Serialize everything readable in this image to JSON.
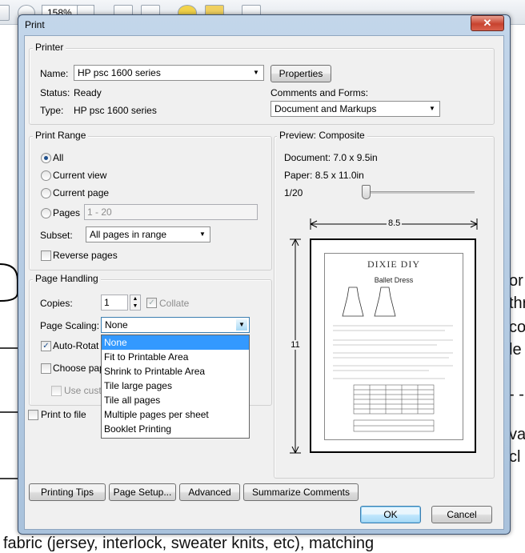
{
  "background": {
    "zoom": "158%",
    "doc_text_right": [
      "or",
      "thr",
      "co",
      "le",
      "- -",
      "va",
      "cl"
    ],
    "doc_text_bottom": "fabric (jersey, interlock, sweater knits, etc), matching"
  },
  "dialog": {
    "title": "Print",
    "close_glyph": "✕",
    "printer": {
      "group_label": "Printer",
      "name_label": "Name:",
      "name_value": "HP psc 1600 series",
      "properties_button": "Properties",
      "status_label": "Status:",
      "status_value": "Ready",
      "type_label": "Type:",
      "type_value": "HP psc 1600 series",
      "comments_label": "Comments and Forms:",
      "comments_value": "Document and Markups"
    },
    "print_range": {
      "group_label": "Print Range",
      "all": "All",
      "current_view": "Current view",
      "current_page": "Current page",
      "pages": "Pages",
      "pages_placeholder": "1 - 20",
      "subset_label": "Subset:",
      "subset_value": "All pages in range",
      "reverse_pages": "Reverse pages"
    },
    "page_handling": {
      "group_label": "Page Handling",
      "copies_label": "Copies:",
      "copies_value": "1",
      "collate": "Collate",
      "page_scaling_label": "Page Scaling:",
      "page_scaling_value": "None",
      "auto_rotate": "Auto-Rotat",
      "choose_paper": "Choose pap",
      "use_custom": "Use custo",
      "scaling_options": [
        "None",
        "Fit to Printable Area",
        "Shrink to Printable Area",
        "Tile large pages",
        "Tile all pages",
        "Multiple pages per sheet",
        "Booklet Printing"
      ]
    },
    "print_to_file": "Print to file",
    "preview": {
      "group_label": "Preview: Composite",
      "document_size": "Document: 7.0 x 9.5in",
      "paper_size": "Paper: 8.5 x 11.0in",
      "page_counter": "1/20",
      "width_dim": "8.5",
      "height_dim": "11",
      "page_brand": "DIXIE DIY",
      "page_title": "Ballet Dress"
    },
    "buttons": {
      "printing_tips": "Printing Tips",
      "page_setup": "Page Setup...",
      "advanced": "Advanced",
      "summarize_comments": "Summarize Comments",
      "ok": "OK",
      "cancel": "Cancel"
    }
  }
}
